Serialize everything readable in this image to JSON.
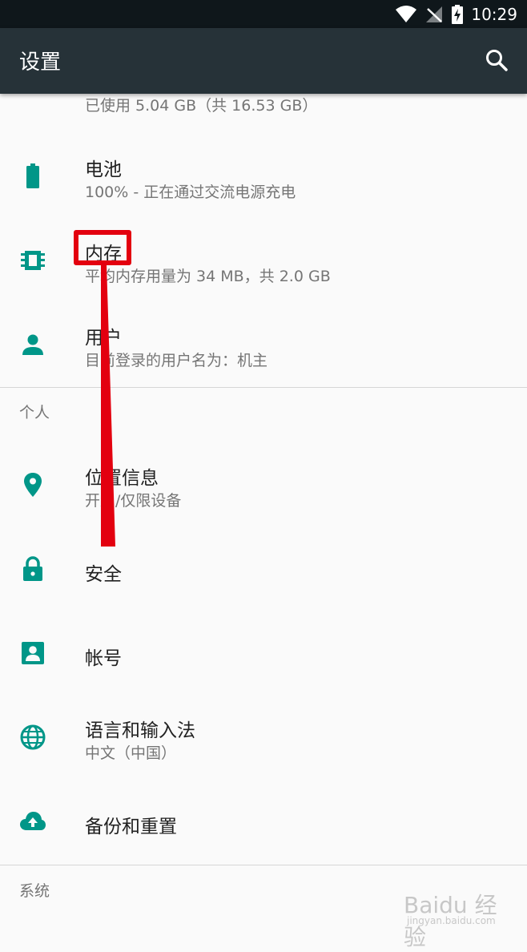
{
  "status_bar": {
    "time": "10:29"
  },
  "app_bar": {
    "title": "设置"
  },
  "storage": {
    "summary": "已使用 5.04 GB（共 16.53 GB）"
  },
  "items": [
    {
      "icon": "battery-charging-icon",
      "title": "电池",
      "summary": "100% - 正在通过交流电源充电"
    },
    {
      "icon": "memory-chip-icon",
      "title": "内存",
      "summary": "平均内存用量为 34 MB，共 2.0 GB"
    },
    {
      "icon": "person-icon",
      "title": "用户",
      "summary": "目前登录的用户名为：机主"
    }
  ],
  "sections": [
    {
      "header": "个人"
    },
    {
      "header": "系统"
    }
  ],
  "personal_items": [
    {
      "icon": "location-icon",
      "title": "位置信息",
      "summary": "开启/仅限设备"
    },
    {
      "icon": "lock-icon",
      "title": "安全",
      "summary": ""
    },
    {
      "icon": "account-icon",
      "title": "帐号",
      "summary": ""
    },
    {
      "icon": "globe-icon",
      "title": "语言和输入法",
      "summary": "中文（中国）"
    },
    {
      "icon": "cloud-upload-icon",
      "title": "备份和重置",
      "summary": ""
    }
  ],
  "watermark": {
    "text": "Baidu 经验",
    "sub": "jingyan.baidu.com"
  },
  "colors": {
    "accent": "#009688",
    "app_bar": "#263238",
    "status_bar": "#0f171b",
    "annotation": "#e3000f"
  }
}
